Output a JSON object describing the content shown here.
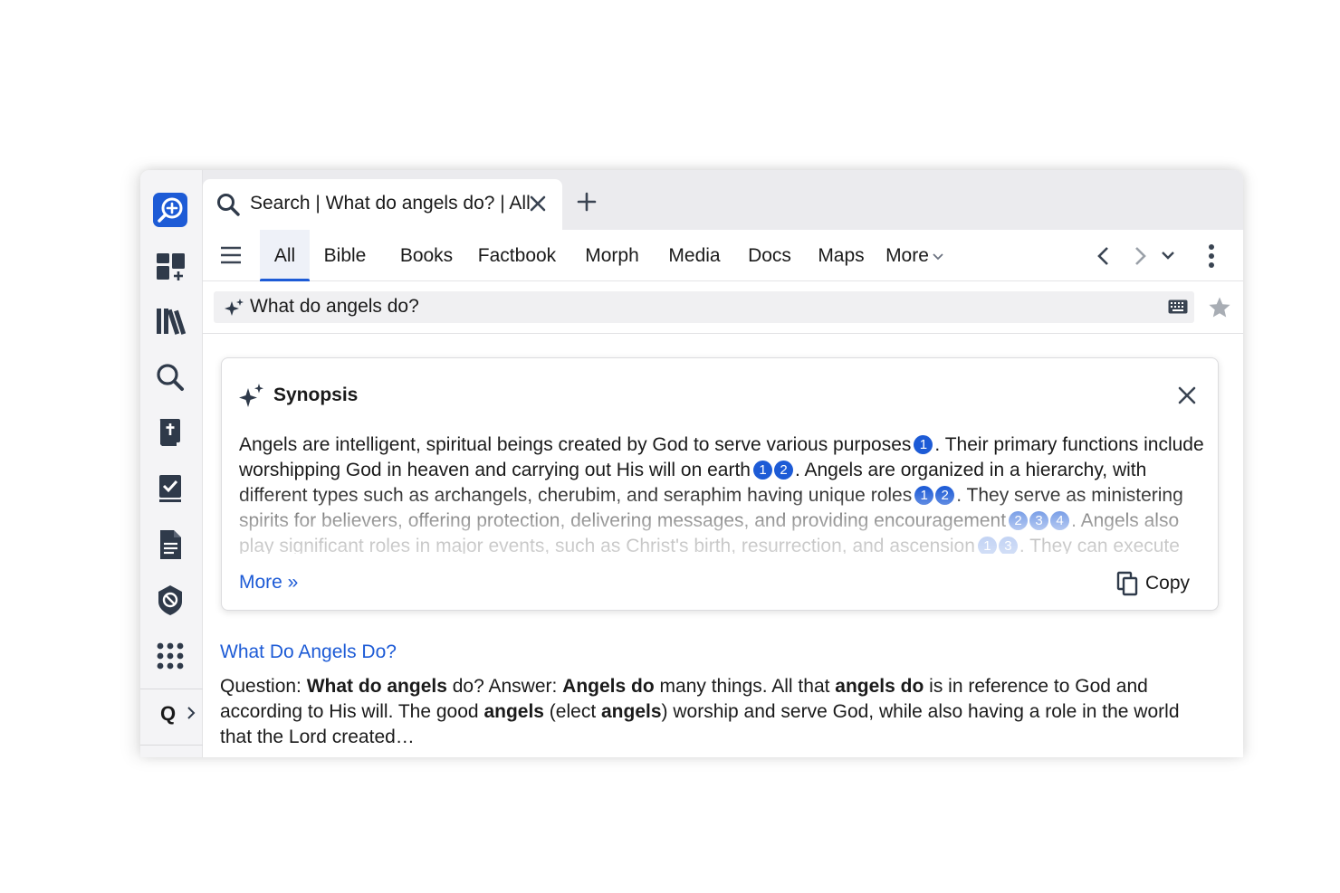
{
  "tab": {
    "title": "Search | What do angels do? | All"
  },
  "nav": {
    "tabs": [
      {
        "label": "All",
        "active": true
      },
      {
        "label": "Bible",
        "active": false
      },
      {
        "label": "Books",
        "active": false
      },
      {
        "label": "Factbook",
        "active": false
      },
      {
        "label": "Morph",
        "active": false
      },
      {
        "label": "Media",
        "active": false
      },
      {
        "label": "Docs",
        "active": false
      },
      {
        "label": "Maps",
        "active": false
      }
    ],
    "more_label": "More"
  },
  "search": {
    "query": "What do angels do?"
  },
  "sidebar": {
    "icons": [
      "search-plus-icon",
      "dashboard-add-icon",
      "library-icon",
      "search-icon",
      "bible-icon",
      "checklist-icon",
      "document-icon",
      "shield-icon",
      "apps-grid-icon"
    ],
    "quick_label": "Q"
  },
  "synopsis": {
    "title": "Synopsis",
    "segments": [
      {
        "text": "Angels are intelligent, spiritual beings created by God to serve various purposes",
        "cites": [
          "1"
        ]
      },
      {
        "text": ". Their primary functions include worshipping God in heaven and carrying out His will on earth",
        "cites": [
          "1",
          "2"
        ]
      },
      {
        "text": ". Angels are organized in a hierarchy, with different types such as archangels, cherubim, and seraphim having unique roles",
        "cites": [
          "1",
          "2"
        ]
      },
      {
        "text": ". They serve as ministering spirits for believers, offering protection, delivering messages, and providing encouragement",
        "cites": [
          "2",
          "3",
          "4"
        ]
      },
      {
        "text": ". Angels also play significant roles in major events, such as Christ's birth, resurrection, and ascension",
        "cites": [
          "1",
          "3"
        ]
      },
      {
        "text": ". They can execute",
        "cites": []
      }
    ],
    "more_label": "More »",
    "copy_label": "Copy"
  },
  "result": {
    "title": "What Do Angels Do?",
    "snippet": [
      {
        "text": "Question: ",
        "bold": false
      },
      {
        "text": "What do angels",
        "bold": true
      },
      {
        "text": " do? Answer: ",
        "bold": false
      },
      {
        "text": "Angels do",
        "bold": true
      },
      {
        "text": " many things. All that ",
        "bold": false
      },
      {
        "text": "angels do",
        "bold": true
      },
      {
        "text": " is in reference to God and according to His will. The good ",
        "bold": false
      },
      {
        "text": "angels",
        "bold": true
      },
      {
        "text": " (elect ",
        "bold": false
      },
      {
        "text": "angels",
        "bold": true
      },
      {
        "text": ") worship and serve God, while also having a role in the world that the Lord created…",
        "bold": false
      }
    ]
  },
  "colors": {
    "accent": "#1d5bd6",
    "icon_dark": "#2f3a4a",
    "sidebar_bg": "#f4f4f6",
    "tabstrip_bg": "#ebebee"
  }
}
